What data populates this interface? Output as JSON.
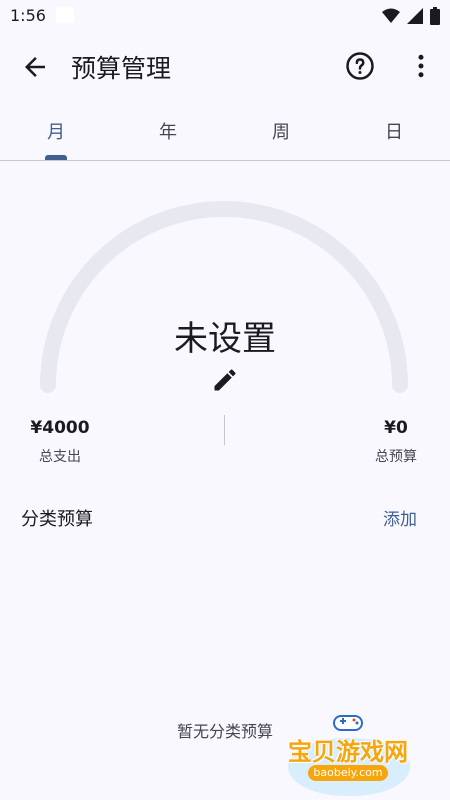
{
  "status_bar": {
    "time": "1:56"
  },
  "app_bar": {
    "title": "预算管理"
  },
  "tabs": [
    {
      "label": "月",
      "active": true
    },
    {
      "label": "年",
      "active": false
    },
    {
      "label": "周",
      "active": false
    },
    {
      "label": "日",
      "active": false
    }
  ],
  "gauge": {
    "status": "未设置",
    "progress": 0
  },
  "stats": {
    "total_expense_value": "¥4000",
    "total_expense_label": "总支出",
    "total_budget_value": "¥0",
    "total_budget_label": "总预算"
  },
  "category_section": {
    "title": "分类预算",
    "add_label": "添加",
    "empty_text": "暂无分类预算"
  },
  "watermark": {
    "text": "宝贝游戏网",
    "url": "baobeiy.com"
  },
  "colors": {
    "accent": "#3e5f90",
    "background": "#f9f8ff",
    "gauge_track": "#e8e9f0"
  },
  "icons": [
    "back-arrow-icon",
    "help-icon",
    "more-vert-icon",
    "edit-icon",
    "wifi-icon",
    "signal-icon",
    "battery-icon"
  ]
}
